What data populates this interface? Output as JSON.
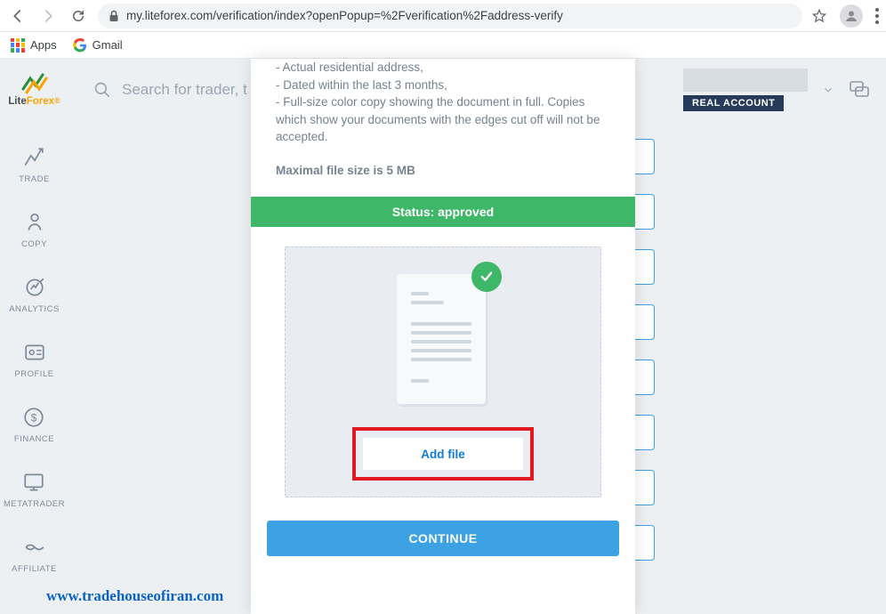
{
  "browser": {
    "url": "my.liteforex.com/verification/index?openPopup=%2Fverification%2Faddress-verify",
    "bookmarks": {
      "apps": "Apps",
      "gmail": "Gmail"
    }
  },
  "app": {
    "logo": {
      "lite": "Lite",
      "forex": "Forex"
    },
    "search_placeholder": "Search for trader, t",
    "account_badge": "REAL ACCOUNT"
  },
  "sidebar": [
    {
      "label": "TRADE"
    },
    {
      "label": "COPY"
    },
    {
      "label": "ANALYTICS"
    },
    {
      "label": "PROFILE"
    },
    {
      "label": "FINANCE"
    },
    {
      "label": "METATRADER"
    },
    {
      "label": "AFFILIATE"
    }
  ],
  "panel": {
    "bullets": [
      "- Actual residential address,",
      "- Dated within the last 3 months,",
      "- Full-size color copy showing the document in full. Copies which show your documents with the edges cut off will not be accepted."
    ],
    "max_size": "Maximal file size is 5 MB",
    "status": "Status: approved",
    "add_file": "Add file",
    "continue": "CONTINUE"
  },
  "watermark": "www.tradehouseofiran.com"
}
